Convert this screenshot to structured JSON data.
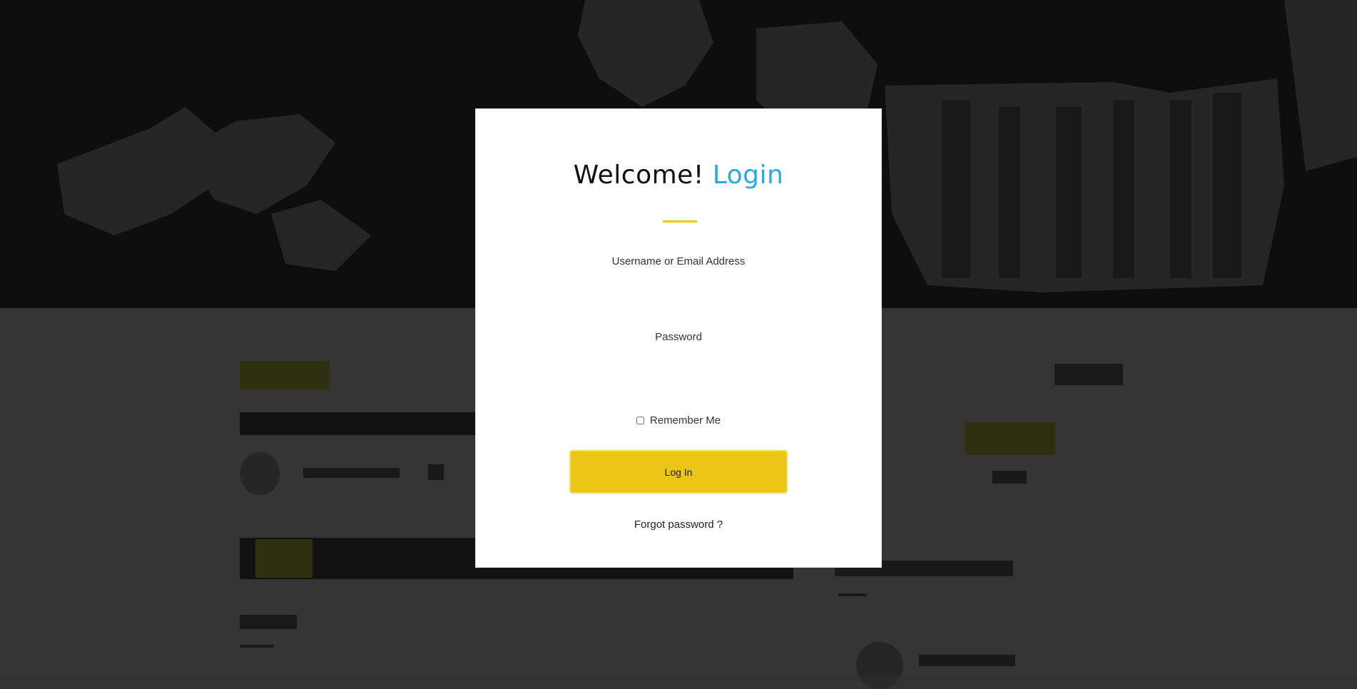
{
  "modal": {
    "title_main": "Welcome!",
    "title_accent": "Login",
    "username_label": "Username or Email Address",
    "password_label": "Password",
    "remember_label": "Remember Me",
    "login_button": "Log In",
    "forgot_link": "Forgot password ?"
  },
  "colors": {
    "accent_blue": "#29a9e1",
    "accent_yellow": "#ecc617",
    "modal_bg": "#ffffff",
    "backdrop": "#3a3a3a"
  }
}
